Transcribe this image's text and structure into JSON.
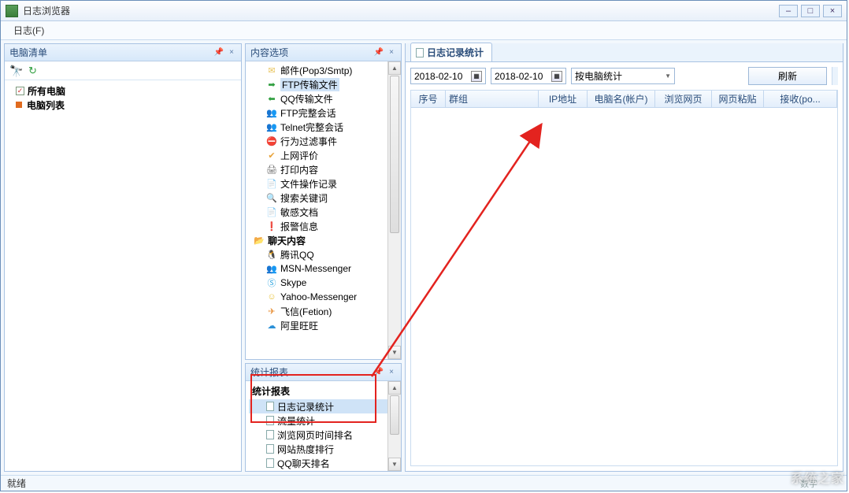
{
  "window": {
    "title": "日志浏览器",
    "minimize": "–",
    "maximize": "□",
    "close": "×"
  },
  "menu": {
    "log": "日志(F)"
  },
  "left": {
    "title": "电脑清单",
    "pin": "📌",
    "close": "×",
    "items": {
      "all": "所有电脑",
      "list": "电脑列表"
    }
  },
  "mid_top": {
    "title": "内容选项",
    "items": [
      "邮件(Pop3/Smtp)",
      "FTP传输文件",
      "QQ传输文件",
      "FTP完整会话",
      "Telnet完整会话",
      "行为过滤事件",
      "上网评价",
      "打印内容",
      "文件操作记录",
      "搜索关键词",
      "敏感文档",
      "报警信息"
    ],
    "chat_group": "聊天内容",
    "chat_items": [
      "腾讯QQ",
      "MSN-Messenger",
      "Skype",
      "Yahoo-Messenger",
      "飞信(Fetion)",
      "阿里旺旺"
    ]
  },
  "mid_bot": {
    "title": "统计报表",
    "group": "统计报表",
    "items": [
      "日志记录统计",
      "流量统计",
      "浏览网页时间排名",
      "网站热度排行",
      "QQ聊天排名"
    ]
  },
  "right": {
    "tab": "日志记录统计",
    "date_from": "2018-02-10",
    "date_to": "2018-02-10",
    "stat_by": "按电脑统计",
    "refresh_btn": "刷新",
    "columns": {
      "seq": "序号",
      "group": "群组",
      "ip": "IP地址",
      "pc": "电脑名(帐户)",
      "browse": "浏览网页",
      "paste": "网页粘贴",
      "recv": "接收(po..."
    }
  },
  "status": {
    "ready": "就绪",
    "num": "数字"
  },
  "watermark": "系统之家"
}
